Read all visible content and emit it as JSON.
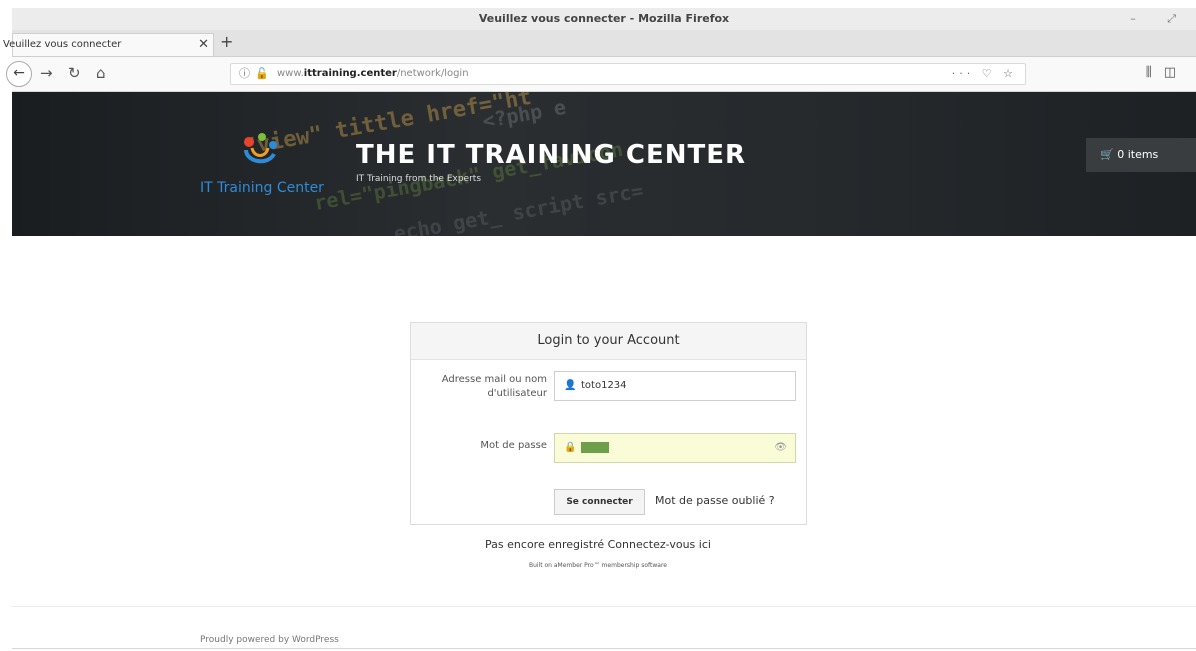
{
  "browser": {
    "window_title": "Veuillez vous connecter - Mozilla Firefox",
    "tab_title": "Veuillez vous connecter",
    "url_prefix": "www.",
    "url_domain": "ittraining.center",
    "url_path": "/network/login"
  },
  "site": {
    "logo_text": "IT Training Center",
    "title": "THE IT TRAINING CENTER",
    "tagline": "IT Training from the Experts",
    "cart_label": "0 items"
  },
  "login": {
    "heading": "Login to your Account",
    "username_label": "Adresse mail ou nom d'utilisateur",
    "username_value": "toto1234",
    "password_label": "Mot de passe",
    "submit_label": "Se connecter",
    "forgot_label": "Mot de passe oublié ?"
  },
  "register_line": "Pas encore enregistré Connectez-vous ici",
  "built_on": "Built on aMember Pro™ membership software",
  "footer": "Proudly powered by WordPress"
}
